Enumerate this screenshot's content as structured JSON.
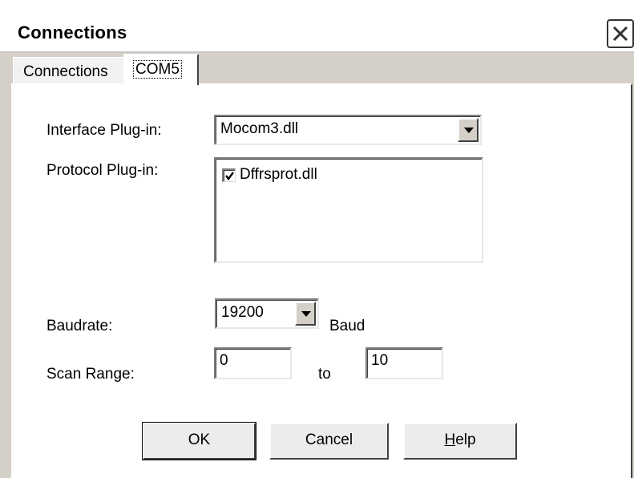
{
  "window": {
    "title": "Connections"
  },
  "tabs": [
    {
      "label": "Connections"
    },
    {
      "label": "COM5"
    }
  ],
  "interface_plugin": {
    "label": "Interface Plug-in:",
    "value": "Mocom3.dll"
  },
  "protocol_plugin": {
    "label": "Protocol Plug-in:",
    "items": [
      {
        "label": "Dffrsprot.dll",
        "checked": true
      }
    ]
  },
  "baudrate": {
    "label": "Baudrate:",
    "value": "19200",
    "unit": "Baud"
  },
  "scan_range": {
    "label": "Scan Range:",
    "from": "0",
    "to_label": "to",
    "to": "10"
  },
  "buttons": {
    "ok": "OK",
    "cancel": "Cancel",
    "help_mnemonic": "H",
    "help_rest": "elp"
  },
  "icons": {
    "close": "close-icon",
    "dropdown": "chevron-down-icon",
    "check": "checkmark-icon"
  }
}
